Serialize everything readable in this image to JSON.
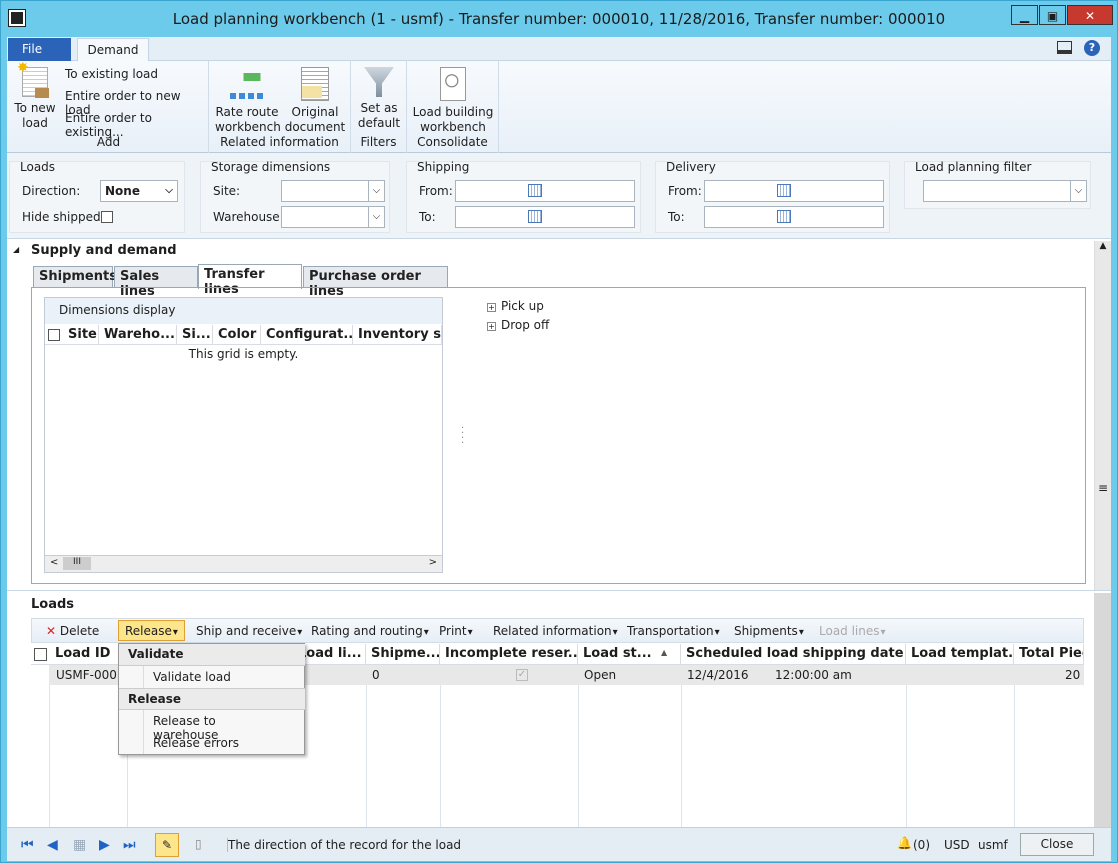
{
  "window": {
    "title": "Load planning workbench (1 - usmf) - Transfer number: 000010, 11/28/2016, Transfer number: 000010",
    "controls": [
      "minimize",
      "maximize",
      "close"
    ]
  },
  "ribbon": {
    "file_label": "File",
    "tab_label": "Demand",
    "add": {
      "to_new_load": "To new load",
      "to_existing_load": "To existing load",
      "entire_order_new": "Entire order to new load",
      "entire_order_existing": "Entire order to existing...",
      "group": "Add"
    },
    "related": {
      "rate_route": "Rate route workbench",
      "original_document": "Original document",
      "group": "Related information"
    },
    "filters": {
      "set_default": "Set as default",
      "group": "Filters"
    },
    "consolidate": {
      "load_building": "Load building workbench",
      "group": "Consolidate"
    }
  },
  "filters": {
    "loads": {
      "title": "Loads",
      "direction_label": "Direction:",
      "direction_value": "None",
      "hide_shipped_label": "Hide shipped:"
    },
    "storage": {
      "title": "Storage dimensions",
      "site_label": "Site:",
      "warehouse_label": "Warehouse:"
    },
    "shipping": {
      "title": "Shipping",
      "from_label": "From:",
      "to_label": "To:"
    },
    "delivery": {
      "title": "Delivery",
      "from_label": "From:",
      "to_label": "To:"
    },
    "load_planning_filter": {
      "title": "Load planning filter"
    }
  },
  "supply": {
    "title": "Supply and demand",
    "tabs": [
      "Shipments",
      "Sales lines",
      "Transfer lines",
      "Purchase order lines"
    ],
    "active_tab": "Transfer lines",
    "dimensions_display": "Dimensions display",
    "columns": [
      "Site",
      "Wareho...",
      "Si...",
      "Color",
      "Configurat...",
      "Inventory st..."
    ],
    "empty": "This grid is empty.",
    "tree": [
      "Pick up",
      "Drop off"
    ]
  },
  "loads": {
    "title": "Loads",
    "toolbar": {
      "delete": "Delete",
      "release": "Release",
      "ship_receive": "Ship and receive",
      "rating_routing": "Rating and routing",
      "print": "Print",
      "related_info": "Related information",
      "transportation": "Transportation",
      "shipments": "Shipments",
      "load_lines": "Load lines"
    },
    "columns": [
      "Load ID",
      "Load li...",
      "Shipme...",
      "Incomplete reser...",
      "Load st...",
      "Scheduled load shipping date ...",
      "Load templat...",
      "Total Piec"
    ],
    "rows": [
      {
        "load_id": "USMF-000...",
        "shipments": "0",
        "incomplete": true,
        "status": "Open",
        "date": "12/4/2016",
        "time": "12:00:00 am",
        "total": "20"
      }
    ],
    "menu": {
      "validate_header": "Validate",
      "validate_load": "Validate load",
      "release_header": "Release",
      "release_to_warehouse": "Release to warehouse",
      "release_errors": "Release errors"
    }
  },
  "status": {
    "message": "The direction of the record for the load",
    "notifications": "(0)",
    "currency": "USD",
    "company": "usmf",
    "close": "Close"
  },
  "colors": {
    "title_bar": "#6ccbea",
    "file_button": "#2a63b8",
    "highlight": "#fde58c"
  }
}
